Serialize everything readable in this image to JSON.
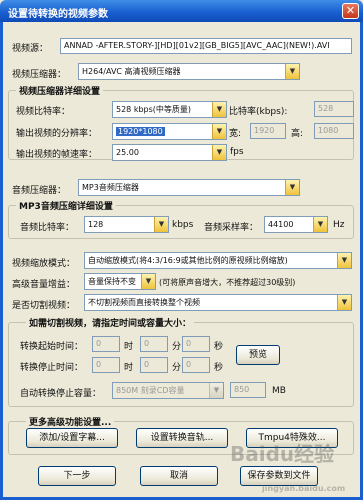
{
  "window": {
    "title": "设置待转换的视频参数",
    "close_glyph": "✕"
  },
  "video_source": {
    "label": "视频源：",
    "value": "ANNAD -AFTER.STORY-][HD][01v2][GB_BIG5][AVC_AAC](NEW!).AVI"
  },
  "video_compressor": {
    "label": "视频压缩器：",
    "value": "H264/AVC 高清视频压缩器"
  },
  "video_detail": {
    "title": "视频压缩器详细设置",
    "bitrate_label": "视频比特率：",
    "bitrate_value": "528  kbps(中等质量)",
    "bitrate_input_label": "比特率(kbps):",
    "bitrate_input_value": "528",
    "resolution_label": "输出视频的分辨率：",
    "resolution_value": "1920*1080",
    "width_label": "宽:",
    "width_value": "1920",
    "height_label": "高:",
    "height_value": "1080",
    "framerate_label": "输出视频的帧速率：",
    "framerate_value": "25.00",
    "framerate_unit": "fps"
  },
  "audio_compressor": {
    "label": "音频压缩器：",
    "value": "MP3音频压缩器"
  },
  "audio_detail": {
    "title": "MP3音频压缩详细设置",
    "bitrate_label": "音频比特率：",
    "bitrate_value": "128",
    "bitrate_unit": "kbps",
    "samplerate_label": "音频采样率：",
    "samplerate_value": "44100",
    "samplerate_unit": "Hz"
  },
  "scaling": {
    "label": "视频缩放模式：",
    "value": "自动缩放模式(将4:3/16:9或其他比例的原视频比例缩放)"
  },
  "volume": {
    "label": "高级音量增益：",
    "value": "音量保持不变",
    "hint": "(可将原声音增大，不推荐超过30级别)"
  },
  "cut": {
    "label": "是否切割视频：",
    "value": "不切割视频而直接转换整个视频"
  },
  "cut_group": {
    "title": "如需切割视频，请指定时间或容量大小：",
    "start_label": "转换起始时间：",
    "stop_label": "转换停止时间：",
    "start_h": "0",
    "start_m": "0",
    "start_s": "0",
    "stop_h": "0",
    "stop_m": "0",
    "stop_s": "0",
    "hour_unit": "时",
    "minute_unit": "分",
    "second_unit": "秒",
    "preview_button": "预览",
    "capacity_label": "自动转换停止容量：",
    "capacity_value": "850M 刻录CD容量",
    "capacity_input": "850",
    "capacity_unit": "MB"
  },
  "advanced": {
    "title": "更多高级功能设置...",
    "subtitle_button": "添加/设置字幕...",
    "audio_track_button": "设置转换音轨...",
    "special_button": "Tmpu4特殊效..."
  },
  "footer": {
    "next_button": "下一步",
    "cancel_button": "取消",
    "save_button": "保存参数到文件"
  },
  "watermark": {
    "text": "Baidu经验",
    "url": "jingyan.baidu.com"
  },
  "icons": {
    "dropdown": "▼"
  }
}
